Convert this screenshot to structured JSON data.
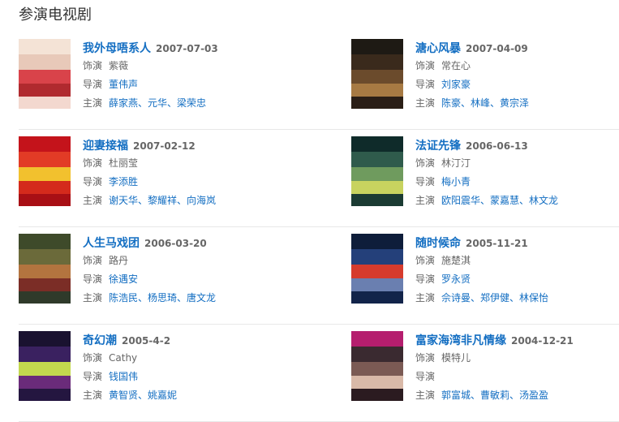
{
  "section_title": "参演电视剧",
  "labels": {
    "role": "饰演",
    "director": "导演",
    "stars": "主演"
  },
  "dramas": [
    {
      "title": "我外母唔系人",
      "date": "2007-07-03",
      "role": "紫薇",
      "director": "董伟声",
      "stars": "薛家燕、元华、梁荣忠",
      "poster_colors": [
        "#f4e3d6",
        "#e8c9b9",
        "#d9434a",
        "#b02a2f",
        "#f3d8cf"
      ]
    },
    {
      "title": "溏心风暴",
      "date": "2007-04-09",
      "role": "常在心",
      "director": "刘家豪",
      "stars": "陈豪、林峰、黄宗泽",
      "poster_colors": [
        "#1e1a14",
        "#3a2a1c",
        "#6b4b2c",
        "#a77a43",
        "#2a1e16"
      ]
    },
    {
      "title": "迎妻接福",
      "date": "2007-02-12",
      "role": "杜丽莹",
      "director": "李添胜",
      "stars": "谢天华、黎耀祥、向海岚",
      "poster_colors": [
        "#c4131b",
        "#e23b26",
        "#f2c12e",
        "#d42a1c",
        "#a80f15"
      ]
    },
    {
      "title": "法证先锋",
      "date": "2006-06-13",
      "role": "林汀汀",
      "director": "梅小青",
      "stars": "欧阳震华、蒙嘉慧、林文龙",
      "poster_colors": [
        "#0f2b2a",
        "#2f5b4c",
        "#6f9b5e",
        "#c8d35f",
        "#1b3b33"
      ]
    },
    {
      "title": "人生马戏团",
      "date": "2006-03-20",
      "role": "路丹",
      "director": "徐遇安",
      "stars": "陈浩民、杨思琦、唐文龙",
      "poster_colors": [
        "#3e4a2a",
        "#6b6a3a",
        "#b3743f",
        "#7b2d26",
        "#2f3a2a"
      ]
    },
    {
      "title": "随时候命",
      "date": "2005-11-21",
      "role": "施楚淇",
      "director": "罗永贤",
      "stars": "佘诗曼、郑伊健、林保怡",
      "poster_colors": [
        "#0e1d3a",
        "#24407a",
        "#d63b2d",
        "#6a7fb0",
        "#12244a"
      ]
    },
    {
      "title": "奇幻潮",
      "date": "2005-4-2",
      "role": "Cathy",
      "director": "钱国伟",
      "stars": "黄智贤、姚嘉妮",
      "poster_colors": [
        "#1a1230",
        "#3a2160",
        "#c3d84e",
        "#6a2b7a",
        "#241640"
      ]
    },
    {
      "title": "富家海湾非凡情缘",
      "date": "2004-12-21",
      "role": "模特儿",
      "director": "",
      "stars": "郭富城、曹敏莉、汤盈盈",
      "poster_colors": [
        "#b51e6e",
        "#3a2a30",
        "#7b5a54",
        "#d9b9a8",
        "#2b1b20"
      ]
    }
  ]
}
